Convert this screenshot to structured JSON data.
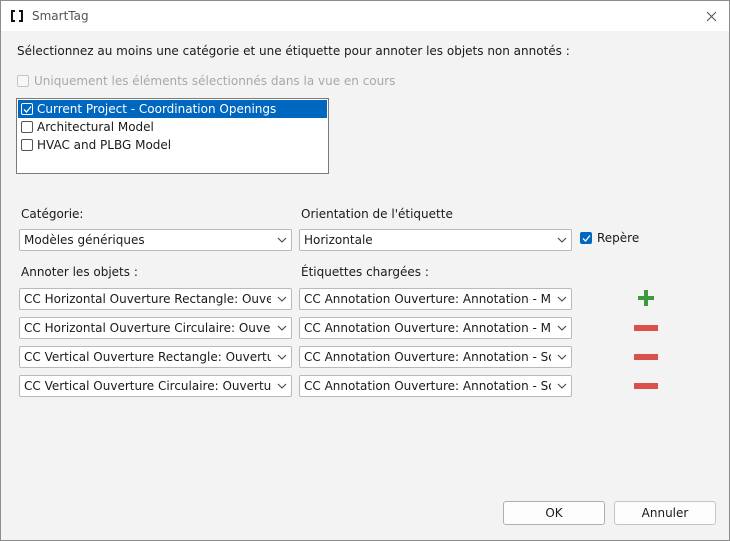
{
  "window": {
    "title": "SmartTag",
    "app_icon": "bracket-logo-icon",
    "close_icon": "close-icon"
  },
  "instruction": "Sélectionnez au moins une catégorie et une étiquette pour annoter les objets non annotés :",
  "only_selected": {
    "label": "Uniquement les éléments sélectionnés dans la vue en cours",
    "checked": false,
    "enabled": false
  },
  "models": [
    {
      "label": "Current Project - Coordination Openings",
      "checked": true,
      "selected": true
    },
    {
      "label": "Architectural Model",
      "checked": false,
      "selected": false
    },
    {
      "label": "HVAC and PLBG Model",
      "checked": false,
      "selected": false
    }
  ],
  "category": {
    "label": "Catégorie:",
    "value": "Modèles génériques"
  },
  "orientation": {
    "label": "Orientation de l'étiquette",
    "value": "Horizontale"
  },
  "repere": {
    "label": "Repère",
    "checked": true
  },
  "objects_label": "Annoter les objets :",
  "tags_label": "Étiquettes chargées :",
  "rows": [
    {
      "object": "CC Horizontal Ouverture Rectangle: Ouverture",
      "tag": "CC Annotation Ouverture: Annotation - Mur - C",
      "action": "add"
    },
    {
      "object": "CC Horizontal Ouverture Circulaire: Ouverture -",
      "tag": "CC Annotation Ouverture: Annotation - Mur - C",
      "action": "remove"
    },
    {
      "object": "CC Vertical Ouverture Rectangle: Ouverture - Re",
      "tag": "CC Annotation Ouverture: Annotation - Sol - Ou",
      "action": "remove"
    },
    {
      "object": "CC Vertical Ouverture Circulaire: Ouverture - Cir",
      "tag": "CC Annotation Ouverture: Annotation - Sol - Ou",
      "action": "remove"
    }
  ],
  "buttons": {
    "ok": "OK",
    "cancel": "Annuler"
  },
  "colors": {
    "accent": "#0067c0",
    "add": "#3c9a3c",
    "remove": "#d9504c"
  }
}
